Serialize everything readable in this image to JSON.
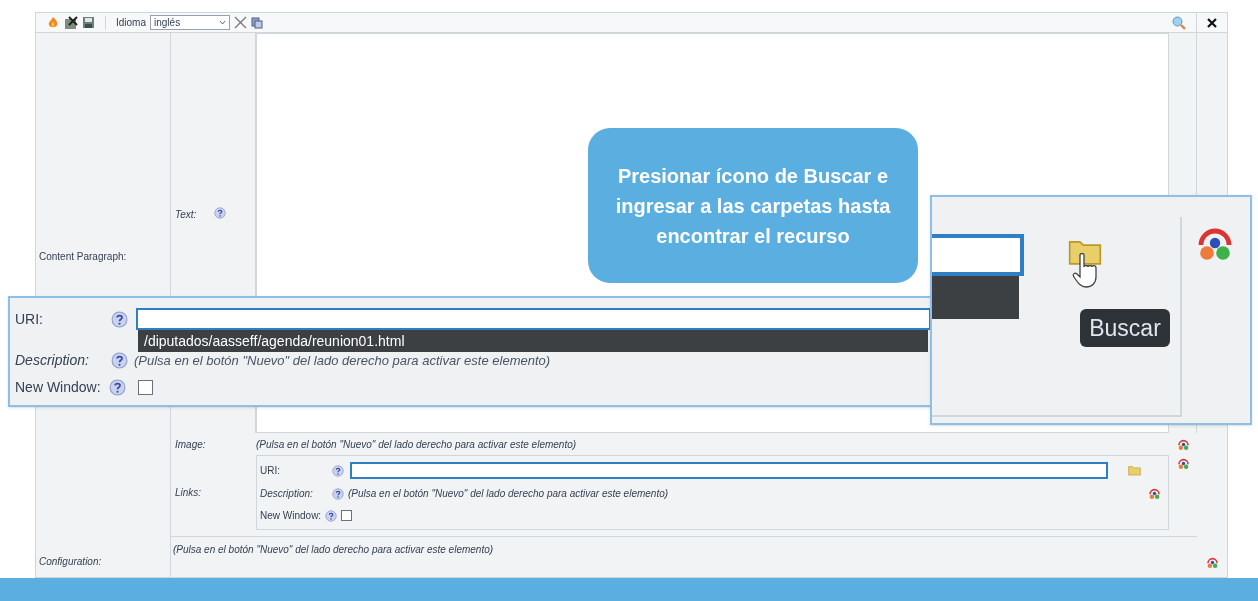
{
  "toolbar": {
    "language_label": "Idioma",
    "language": "inglés"
  },
  "form": {
    "content_label": "Content Paragraph:",
    "text_label": "Text:",
    "image": {
      "label": "Image:",
      "hint": "(Pulsa en el botón \"Nuevo\" del lado derecho para activar este elemento)"
    },
    "links": {
      "label": "Links:",
      "uri_label": "URI:",
      "description_label": "Description:",
      "description_hint": "(Pulsa en el botón \"Nuevo\" del lado derecho para activar este elemento)",
      "new_window_label": "New Window:",
      "new_window_checked": false
    },
    "configuration": {
      "label": "Configuration:",
      "hint": "(Pulsa en el botón \"Nuevo\" del lado derecho para activar este elemento)"
    }
  },
  "zoom_left": {
    "uri_label": "URI:",
    "suggestion": "/diputados/aasseff/agenda/reunion01.html",
    "description_label": "Description:",
    "description_hint": "(Pulsa en el botón \"Nuevo\" del lado derecho para activar este elemento)",
    "new_window_label": "New Window:",
    "new_window_checked": false
  },
  "zoom_right": {
    "tooltip": "Buscar"
  },
  "callout": "Presionar ícono de Buscar e ingresar a las carpetas hasta encontrar el recurso"
}
